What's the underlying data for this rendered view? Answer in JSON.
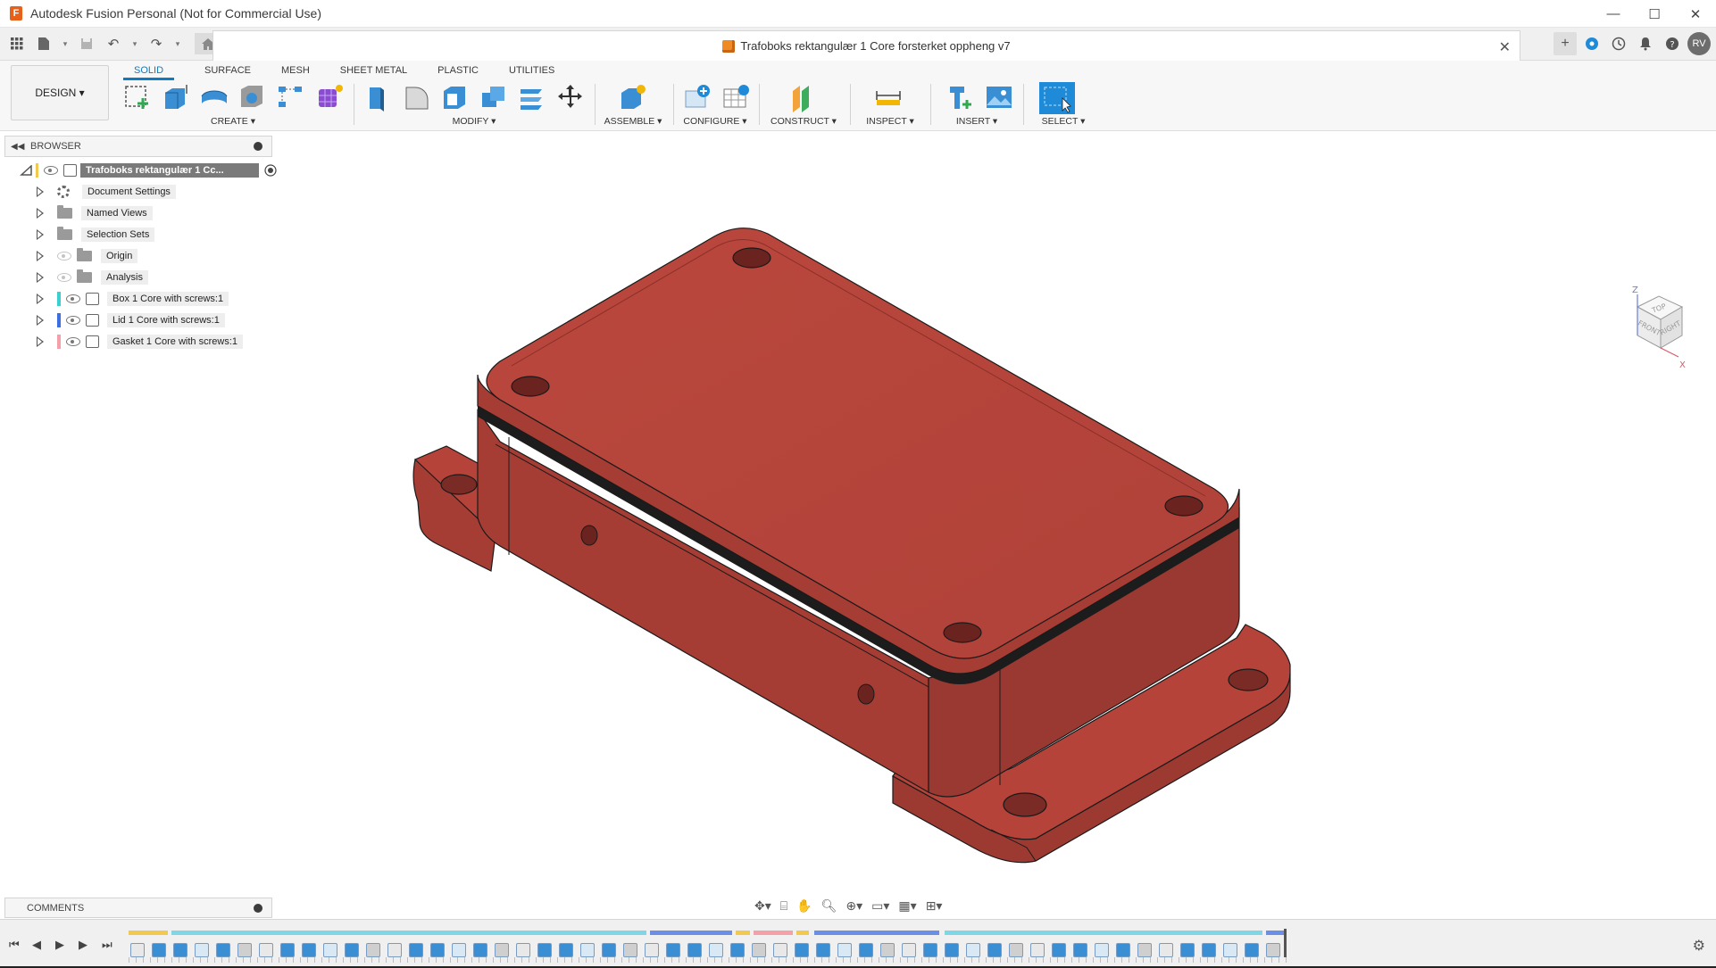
{
  "app": {
    "title": "Autodesk Fusion Personal (Not for Commercial Use)",
    "icon": "F"
  },
  "window_controls": [
    "—",
    "☐",
    "✕"
  ],
  "document": {
    "tab_title": "Trafoboks rektangulær 1 Core forsterket oppheng v7",
    "close_glyph": "✕"
  },
  "toolbar_right": {
    "avatar_initials": "RV"
  },
  "workspace": {
    "label": "DESIGN ▾"
  },
  "ribbon": {
    "tabs": [
      "SOLID",
      "SURFACE",
      "MESH",
      "SHEET METAL",
      "PLASTIC",
      "UTILITIES"
    ],
    "active_tab": "SOLID",
    "groups": {
      "create": "CREATE ▾",
      "modify": "MODIFY ▾",
      "assemble": "ASSEMBLE ▾",
      "configure": "CONFIGURE ▾",
      "construct": "CONSTRUCT ▾",
      "inspect": "INSPECT ▾",
      "insert": "INSERT ▾",
      "select": "SELECT ▾"
    }
  },
  "browser": {
    "title": "BROWSER",
    "root": "Trafoboks rektangulær 1 Cc...",
    "items": [
      {
        "label": "Document Settings",
        "icon": "gear-icon"
      },
      {
        "label": "Named Views",
        "icon": "folder-icon"
      },
      {
        "label": "Selection Sets",
        "icon": "folder-icon"
      },
      {
        "label": "Origin",
        "icon": "folder-icon"
      },
      {
        "label": "Analysis",
        "icon": "folder-icon"
      },
      {
        "label": "Box 1 Core with screws:1",
        "icon": "component-icon",
        "color": "#3ccfcf"
      },
      {
        "label": "Lid 1 Core with screws:1",
        "icon": "component-icon",
        "color": "#3d6fe0"
      },
      {
        "label": "Gasket 1 Core with screws:1",
        "icon": "component-icon",
        "color": "#f4a0a8"
      }
    ]
  },
  "viewcube": {
    "top": "TOP",
    "front": "FRONT",
    "right": "RIGHT",
    "axis_z": "Z",
    "axis_x": "X"
  },
  "comments": {
    "title": "COMMENTS"
  },
  "colors": {
    "model_red": "#b5433a",
    "model_edge": "#1a1a1a",
    "accent_blue": "#0f7bc0"
  }
}
